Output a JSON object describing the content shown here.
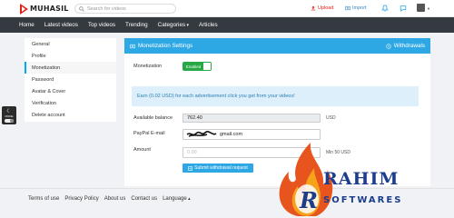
{
  "brand": {
    "logo_text": "MUHASIL"
  },
  "search": {
    "placeholder": "Search for videos"
  },
  "topbar": {
    "upload_label": "Upload",
    "import_label": "Import"
  },
  "nav": {
    "items": [
      "Home",
      "Latest videos",
      "Top videos",
      "Trending",
      "Categories",
      "Articles"
    ]
  },
  "sidebar": {
    "items": [
      "General",
      "Profile",
      "Monetization",
      "Password",
      "Avatar & Cover",
      "Verification",
      "Delete account"
    ],
    "active_index": 2
  },
  "mode_toggle": {
    "label": "MODE"
  },
  "panel": {
    "title": "Monetization Settings",
    "withdrawals_label": "Withdrawals",
    "monetization_label": "Monetization",
    "toggle_label": "Enabled",
    "alert": "Earn (0.02 USD) for each advertisement click you get from your videos!",
    "balance_label": "Available balance",
    "balance_value": "762.40",
    "balance_unit": "USD",
    "paypal_label": "PayPal E-mail",
    "paypal_value": "gmail.com",
    "amount_label": "Amount",
    "amount_placeholder": "0.00",
    "amount_hint": "Min 50 USD",
    "submit_label": "Submit withdrawal request"
  },
  "footer": {
    "links": [
      "Terms of use",
      "Privacy Policy",
      "About us",
      "Contact us",
      "Language"
    ]
  },
  "watermark": {
    "line1": "RAHIM",
    "line2": "SOFTWARES"
  },
  "colors": {
    "accent": "#2ea8e5",
    "navbar": "#343a40",
    "success": "#28a745",
    "brand_red": "#e62117"
  }
}
